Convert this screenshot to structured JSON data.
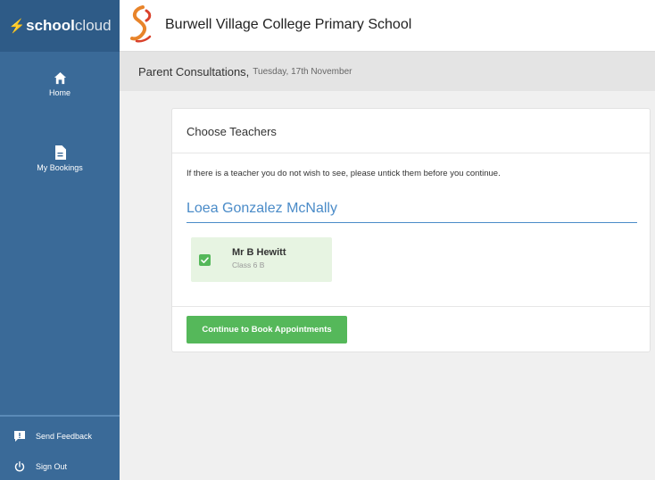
{
  "brand": {
    "bold": "school",
    "light": "cloud"
  },
  "sidebar": {
    "items": [
      {
        "label": "Home",
        "icon": "home-icon"
      },
      {
        "label": "My Bookings",
        "icon": "document-icon"
      }
    ],
    "bottom": [
      {
        "label": "Send Feedback",
        "icon": "feedback-icon"
      },
      {
        "label": "Sign Out",
        "icon": "power-icon"
      }
    ]
  },
  "header": {
    "school": "Burwell Village College Primary School"
  },
  "subheader": {
    "title": "Parent Consultations,",
    "date": "Tuesday, 17th November"
  },
  "card": {
    "title": "Choose Teachers",
    "note": "If there is a teacher you do not wish to see, please untick them before you continue.",
    "student": "Loea Gonzalez McNally",
    "teachers": [
      {
        "name": "Mr B Hewitt",
        "class": "Class 6 B",
        "checked": true
      }
    ],
    "continue_label": "Continue to Book Appointments"
  },
  "colors": {
    "sidebar": "#3a6a98",
    "brand_bg": "#2e5b87",
    "accent_blue": "#4a8bc8",
    "green": "#55b85a",
    "teacher_bg": "#e7f4e2"
  }
}
